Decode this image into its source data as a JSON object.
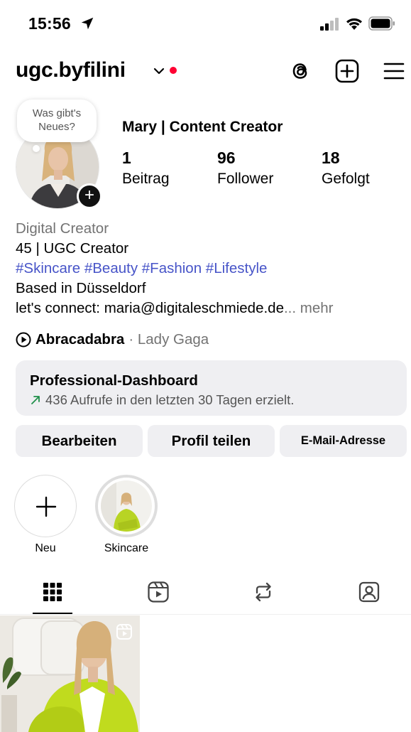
{
  "status_bar": {
    "time": "15:56",
    "icons": [
      "location-arrow-icon",
      "cellular-signal-icon",
      "wifi-icon",
      "battery-icon"
    ]
  },
  "header": {
    "username": "ugc.byfilini",
    "icons": [
      "chevron-down-icon",
      "threads-icon",
      "create-post-icon",
      "hamburger-menu-icon"
    ],
    "unread_dot_color": "#ff0033"
  },
  "profile": {
    "note_text": "Was gibt's Neues?",
    "display_name": "Mary | Content Creator",
    "stats": [
      {
        "count": "1",
        "label": "Beitrag"
      },
      {
        "count": "96",
        "label": "Follower"
      },
      {
        "count": "18",
        "label": "Gefolgt"
      }
    ]
  },
  "bio": {
    "category": "Digital Creator",
    "line1": "45 | UGC Creator",
    "hashtags": "#Skincare #Beauty #Fashion #Lifestyle",
    "line3": "Based in Düsseldorf",
    "line4": "let's connect: maria@digitaleschmiede.de",
    "more": "... mehr"
  },
  "music": {
    "title": "Abracadabra",
    "artist": "· Lady Gaga"
  },
  "dashboard": {
    "title": "Professional-Dashboard",
    "subtitle": "436 Aufrufe in den letzten 30 Tagen erzielt.",
    "trend_color": "#1f8f4a"
  },
  "actions": {
    "edit": "Bearbeiten",
    "share": "Profil teilen",
    "email": "E-Mail-Adresse"
  },
  "highlights": [
    {
      "label": "Neu"
    },
    {
      "label": "Skincare"
    }
  ],
  "tabs": [
    "grid-icon",
    "reels-icon",
    "reposts-icon",
    "tagged-icon"
  ],
  "colors": {
    "hashtag": "#4754c8",
    "muted": "#737373",
    "card_bg": "#efeff2"
  }
}
